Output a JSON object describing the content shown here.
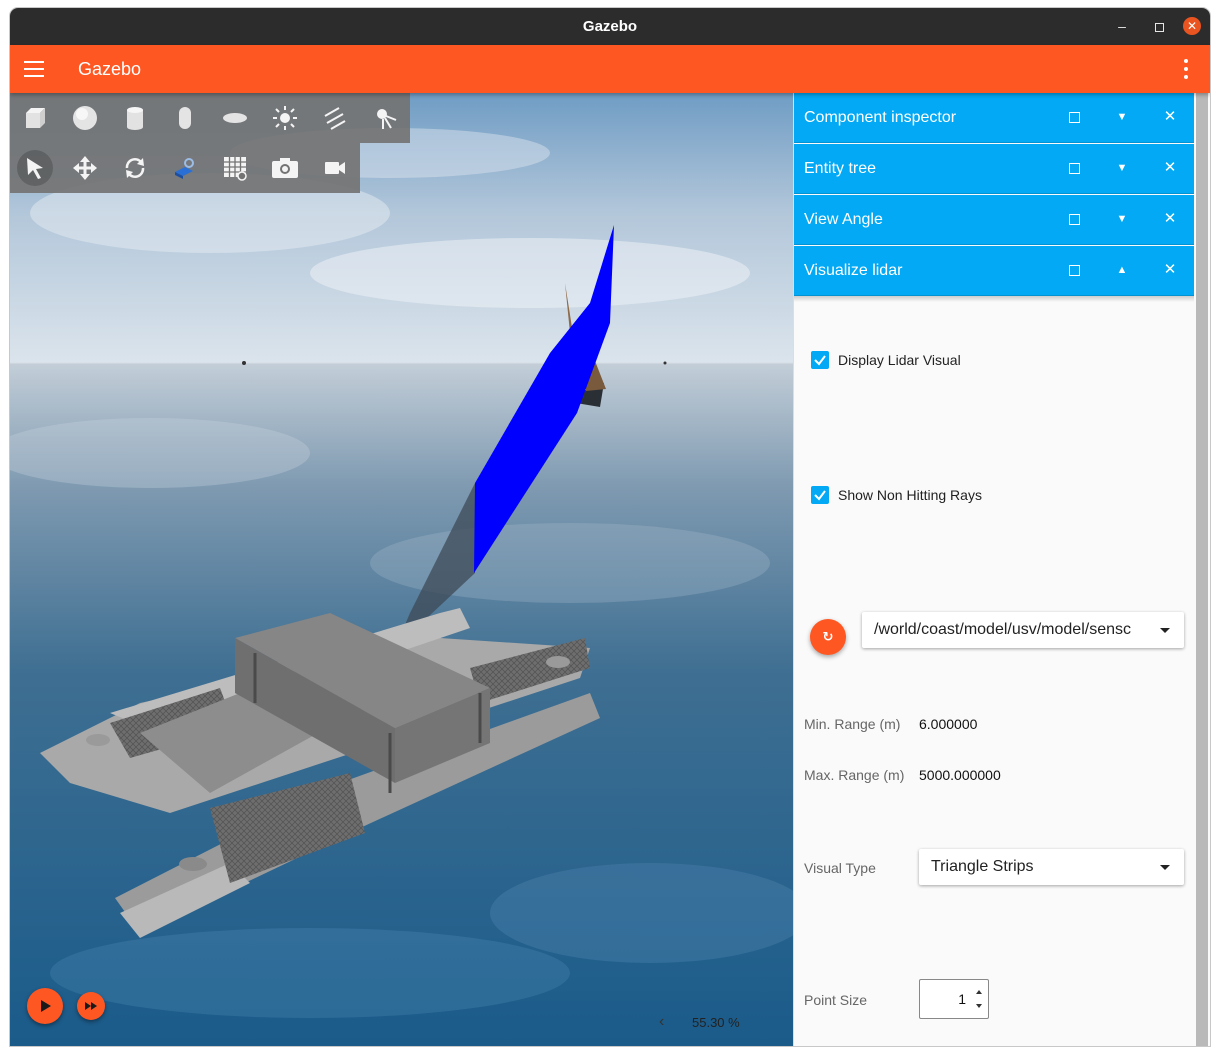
{
  "window": {
    "title": "Gazebo",
    "controls": {
      "minimize": "–",
      "maximize": "□",
      "close": "✕"
    }
  },
  "appbar": {
    "title": "Gazebo"
  },
  "toolbar": {
    "shapes": [
      "box-icon",
      "sphere-icon",
      "cylinder-icon",
      "capsule-icon",
      "ellipsoid-icon",
      "point-light-icon",
      "directional-light-icon",
      "spot-light-icon"
    ],
    "transforms": [
      "select-icon",
      "translate-icon",
      "rotate-icon",
      "transform-control-icon",
      "grid-icon",
      "screenshot-icon",
      "video-record-icon"
    ]
  },
  "sim": {
    "rtf": "55.30 %"
  },
  "panel": {
    "docks": [
      {
        "title": "Component inspector",
        "collapse": "▼"
      },
      {
        "title": "Entity tree",
        "collapse": "▼"
      },
      {
        "title": "View Angle",
        "collapse": "▼"
      },
      {
        "title": "Visualize lidar",
        "collapse": "▲"
      }
    ],
    "close_glyph": "✕",
    "lidar": {
      "display_lidar_visual": {
        "label": "Display Lidar Visual",
        "checked": true
      },
      "show_non_hitting_rays": {
        "label": "Show Non Hitting Rays",
        "checked": true
      },
      "topic": "/world/coast/model/usv/model/sensc",
      "min_range_label": "Min. Range (m)",
      "min_range_value": "6.000000",
      "max_range_label": "Max. Range (m)",
      "max_range_value": "5000.000000",
      "visual_type_label": "Visual Type",
      "visual_type_value": "Triangle Strips",
      "point_size_label": "Point Size",
      "point_size_value": "1"
    }
  },
  "colors": {
    "appbar": "#ff5722",
    "dock": "#03a9f4",
    "titlebar": "#2c2c2c",
    "lidar": "#0000ff"
  }
}
